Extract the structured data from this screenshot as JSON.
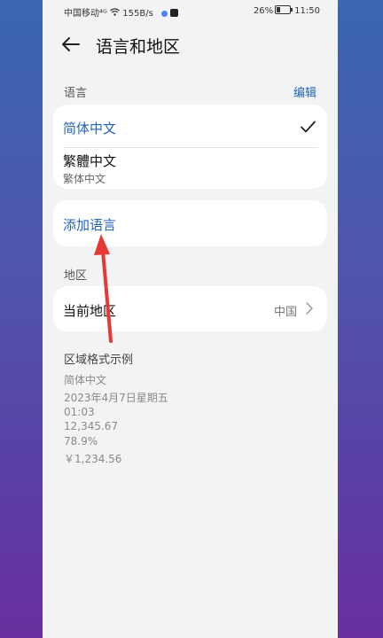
{
  "status_bar": {
    "carrier": "中国移动",
    "network": "⁴ᴳ",
    "speed": "155B/s",
    "battery": "26%",
    "time": "11:50"
  },
  "header": {
    "title": "语言和地区"
  },
  "languages": {
    "section_label": "语言",
    "edit_label": "编辑",
    "items": [
      {
        "label": "简体中文",
        "selected": true
      },
      {
        "label": "繁體中文",
        "sublabel": "繁体中文",
        "selected": false
      }
    ],
    "add_label": "添加语言"
  },
  "region": {
    "section_label": "地区",
    "current_label": "当前地区",
    "current_value": "中国"
  },
  "format_example": {
    "title": "区域格式示例",
    "lines": [
      "简体中文",
      "2023年4月7日星期五",
      "01:03",
      "12,345.67",
      "78.9%",
      "￥1,234.56"
    ]
  },
  "colors": {
    "accent": "#2463b8",
    "annotation_arrow": "#e53935"
  }
}
